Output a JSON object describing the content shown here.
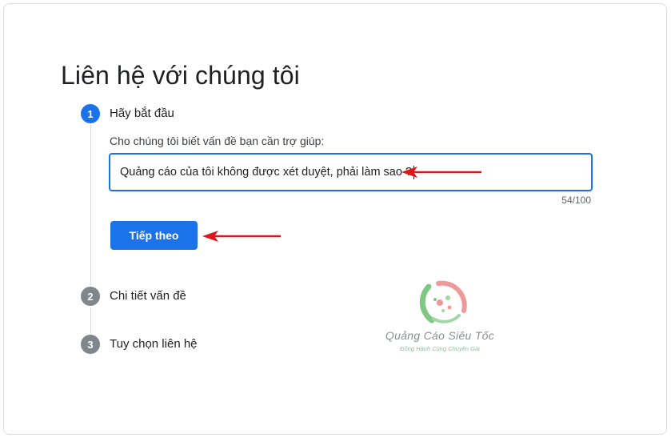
{
  "page": {
    "title": "Liên hệ với chúng tôi"
  },
  "steps": [
    {
      "number": "1",
      "label": "Hãy bắt đầu",
      "state": "active"
    },
    {
      "number": "2",
      "label": "Chi tiết vấn đề",
      "state": "inactive"
    },
    {
      "number": "3",
      "label": "Tuy chọn liên hệ",
      "state": "inactive"
    }
  ],
  "form": {
    "prompt": "Cho chúng tôi biết vấn đề bạn cần trợ giúp:",
    "issue_value": "Quảng cáo của tôi không được xét duyệt, phải làm sao ?",
    "char_count": "54/100",
    "next_label": "Tiếp theo"
  },
  "watermark": {
    "brand": "Quảng Cáo Siêu Tốc",
    "tagline": "Đồng Hành Cùng Chuyên Gia"
  },
  "colors": {
    "accent": "#1a73e8",
    "step_inactive": "#80868b",
    "annotation_arrow": "#e0141b"
  },
  "icons": {
    "annotation": "red-arrow-icon",
    "logo": "quang-cao-sieu-toc-logo"
  }
}
